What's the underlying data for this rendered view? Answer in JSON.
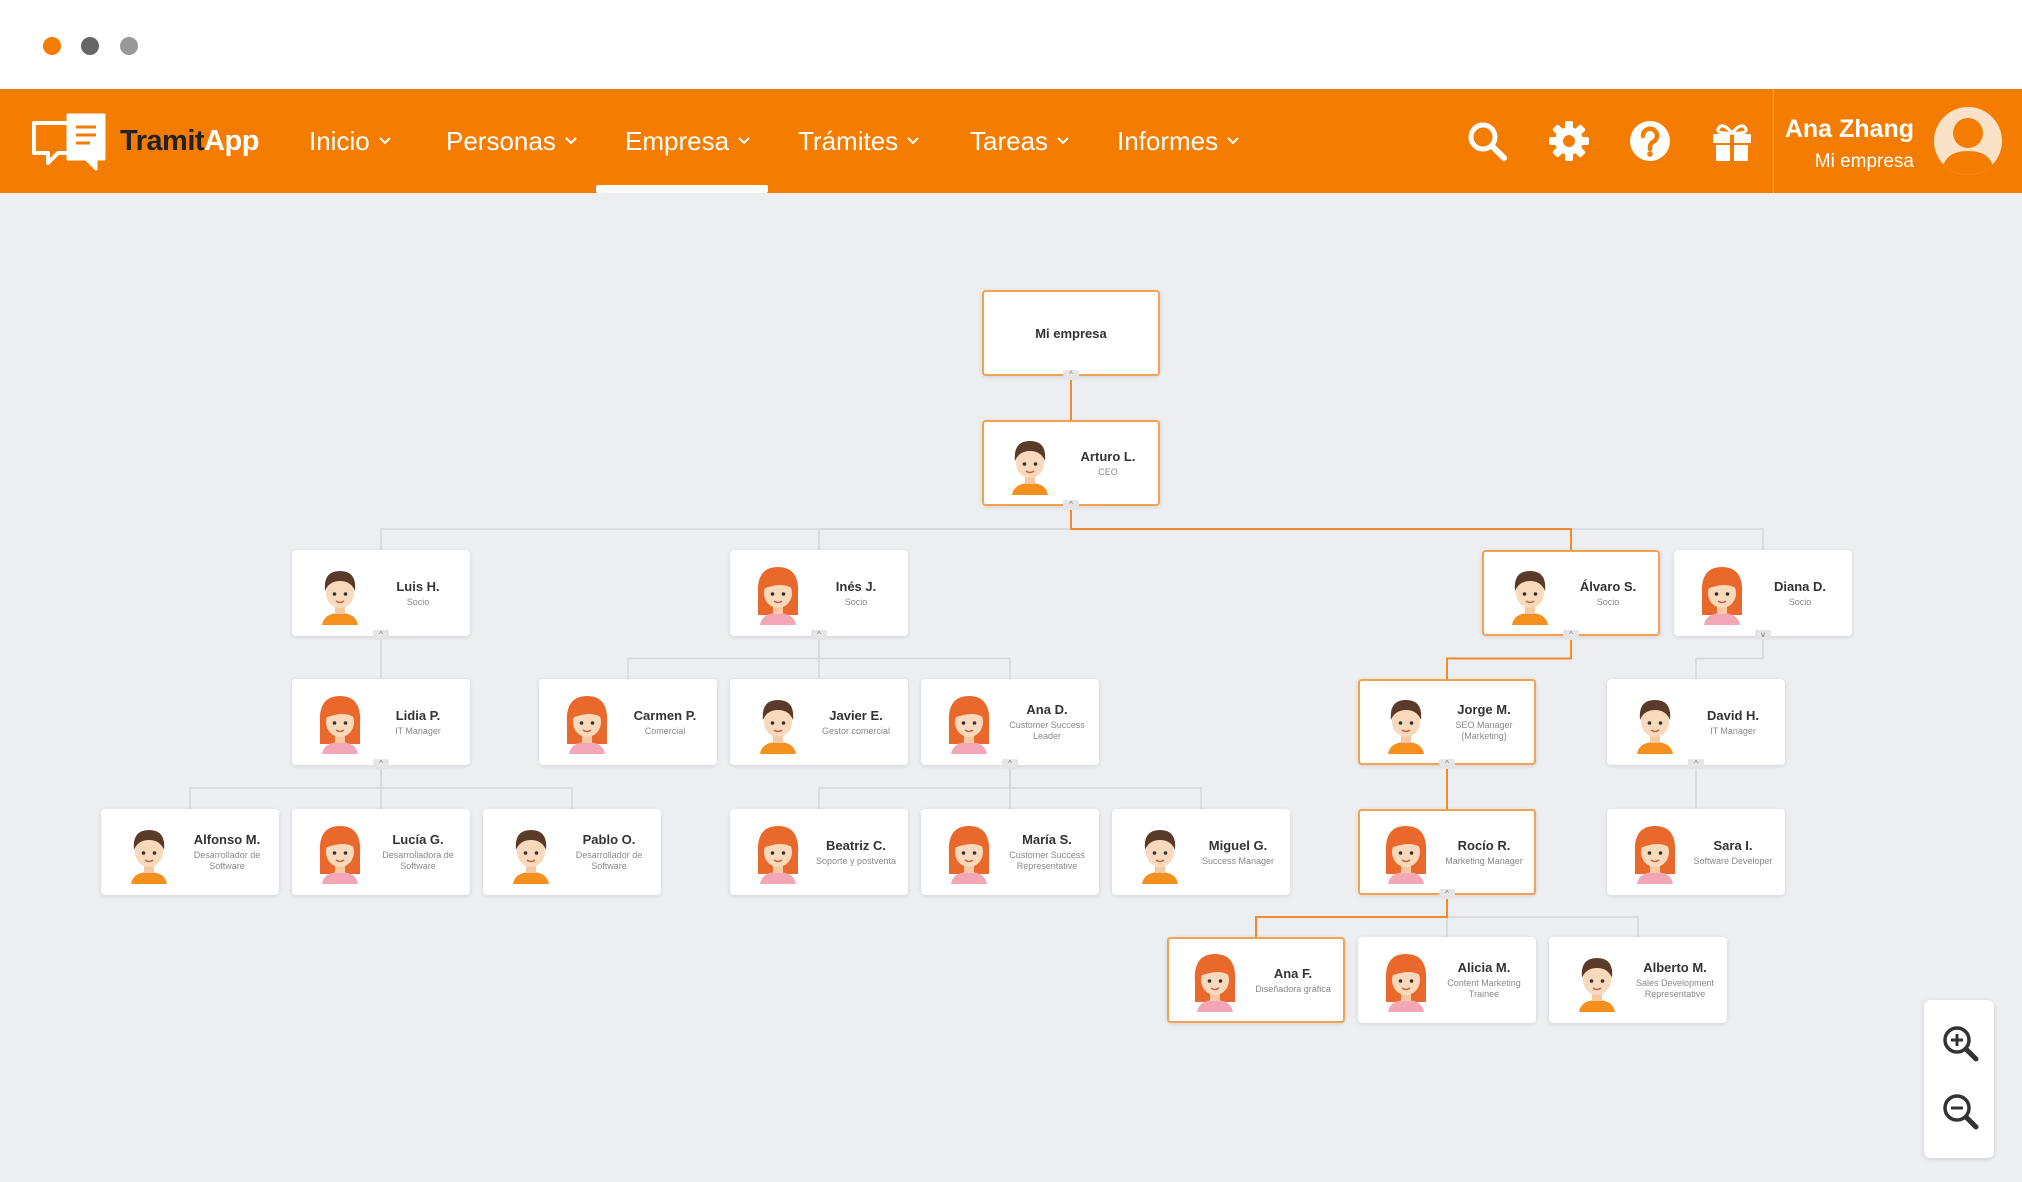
{
  "window": {
    "dots": [
      "#f47c00",
      "#666666",
      "#999999"
    ]
  },
  "brand": {
    "name_part1": "Tramit",
    "name_part2": "App",
    "colors": {
      "primary": "#f47c00",
      "highlight_border": "#f4a24f",
      "canvas": "#eceef1"
    }
  },
  "nav": {
    "items": [
      {
        "label": "Inicio",
        "active": false
      },
      {
        "label": "Personas",
        "active": false
      },
      {
        "label": "Empresa",
        "active": true
      },
      {
        "label": "Trámites",
        "active": false
      },
      {
        "label": "Tareas",
        "active": false
      },
      {
        "label": "Informes",
        "active": false
      }
    ],
    "icons": [
      "search-icon",
      "gear-icon",
      "help-icon",
      "gift-icon"
    ]
  },
  "user": {
    "name": "Ana Zhang",
    "company": "Mi empresa"
  },
  "org": {
    "root": {
      "name": "Mi empresa"
    },
    "nodes": [
      {
        "id": "arturo",
        "name": "Arturo L.",
        "role": "CEO",
        "avatar": "male"
      },
      {
        "id": "luis",
        "name": "Luis H.",
        "role": "Socio",
        "avatar": "male"
      },
      {
        "id": "ines",
        "name": "Inés J.",
        "role": "Socio",
        "avatar": "female"
      },
      {
        "id": "alvaro",
        "name": "Álvaro S.",
        "role": "Socio",
        "avatar": "male"
      },
      {
        "id": "diana",
        "name": "Diana D.",
        "role": "Socio",
        "avatar": "female"
      },
      {
        "id": "lidia",
        "name": "Lidia P.",
        "role": "IT Manager",
        "avatar": "female"
      },
      {
        "id": "carmen",
        "name": "Carmen P.",
        "role": "Comercial",
        "avatar": "female"
      },
      {
        "id": "javier",
        "name": "Javier E.",
        "role": "Gestor comercial",
        "avatar": "male"
      },
      {
        "id": "anad",
        "name": "Ana D.",
        "role": "Customer Success Leader",
        "avatar": "female"
      },
      {
        "id": "jorge",
        "name": "Jorge M.",
        "role": "SEO Manager (Marketing)",
        "avatar": "male"
      },
      {
        "id": "david",
        "name": "David H.",
        "role": "IT Manager",
        "avatar": "male"
      },
      {
        "id": "alfonso",
        "name": "Alfonso M.",
        "role": "Desarrollador de Software",
        "avatar": "male"
      },
      {
        "id": "lucia",
        "name": "Lucía G.",
        "role": "Desarrolladora de Software",
        "avatar": "female"
      },
      {
        "id": "pablo",
        "name": "Pablo O.",
        "role": "Desarrollador de Software",
        "avatar": "male"
      },
      {
        "id": "beatriz",
        "name": "Beatriz C.",
        "role": "Soporte y postventa",
        "avatar": "female"
      },
      {
        "id": "maria",
        "name": "María S.",
        "role": "Customer Success Representative",
        "avatar": "female"
      },
      {
        "id": "miguel",
        "name": "Miguel G.",
        "role": "Success Manager",
        "avatar": "male"
      },
      {
        "id": "rocio",
        "name": "Rocío R.",
        "role": "Marketing Manager",
        "avatar": "female"
      },
      {
        "id": "sara",
        "name": "Sara I.",
        "role": "Software Developer",
        "avatar": "female"
      },
      {
        "id": "anaf",
        "name": "Ana F.",
        "role": "Diseñadora gráfica",
        "avatar": "female"
      },
      {
        "id": "alicia",
        "name": "Alicia M.",
        "role": "Content Marketing Trainee",
        "avatar": "female"
      },
      {
        "id": "alberto",
        "name": "Alberto M.",
        "role": "Sales Development Representative",
        "avatar": "male"
      }
    ]
  },
  "zoom": {
    "icons": [
      "zoom-in-icon",
      "zoom-out-icon"
    ]
  }
}
